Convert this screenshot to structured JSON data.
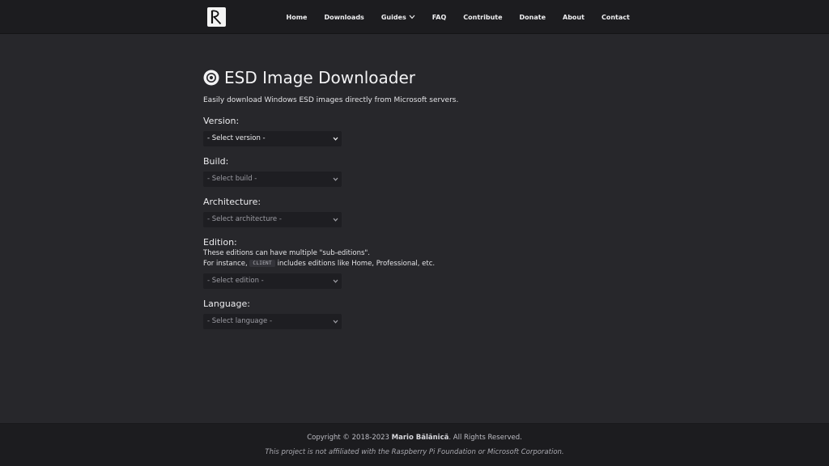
{
  "navbar": {
    "logo_icon": "r-monogram-logo",
    "links": [
      {
        "label": "Home"
      },
      {
        "label": "Downloads"
      },
      {
        "label": "Guides",
        "icon": "chevron-down-icon"
      },
      {
        "label": "FAQ"
      },
      {
        "label": "Contribute"
      },
      {
        "label": "Donate"
      },
      {
        "label": "About"
      },
      {
        "label": "Contact"
      }
    ]
  },
  "main": {
    "title_icon": "disc-icon",
    "title": "ESD Image Downloader",
    "subtitle": "Easily download Windows ESD images directly from Microsoft servers.",
    "fields": {
      "version": {
        "label": "Version:",
        "selected": "- Select version -",
        "enabled": true
      },
      "build": {
        "label": "Build:",
        "selected": "- Select build -",
        "enabled": false
      },
      "architecture": {
        "label": "Architecture:",
        "selected": "- Select architecture -",
        "enabled": false
      },
      "edition": {
        "label": "Edition:",
        "help_line1": "These editions can have multiple \"sub-editions\".",
        "help_line2_prefix": "For instance,",
        "help_code": "CLIENT",
        "help_line2_suffix": "includes editions like Home, Professional, etc.",
        "selected": "- Select edition -",
        "enabled": false
      },
      "language": {
        "label": "Language:",
        "selected": "- Select language -",
        "enabled": false
      }
    }
  },
  "footer": {
    "copyright_prefix": "Copyright © 2018-2023",
    "author": "Mario Bălănică",
    "copyright_suffix": ". All Rights Reserved.",
    "disclaimer": "This project is not affiliated with the Raspberry Pi Foundation or Microsoft Corporation."
  },
  "colors": {
    "background": "#27272b",
    "navbar": "#1c1c1f",
    "select_bg": "#1e1e22"
  }
}
